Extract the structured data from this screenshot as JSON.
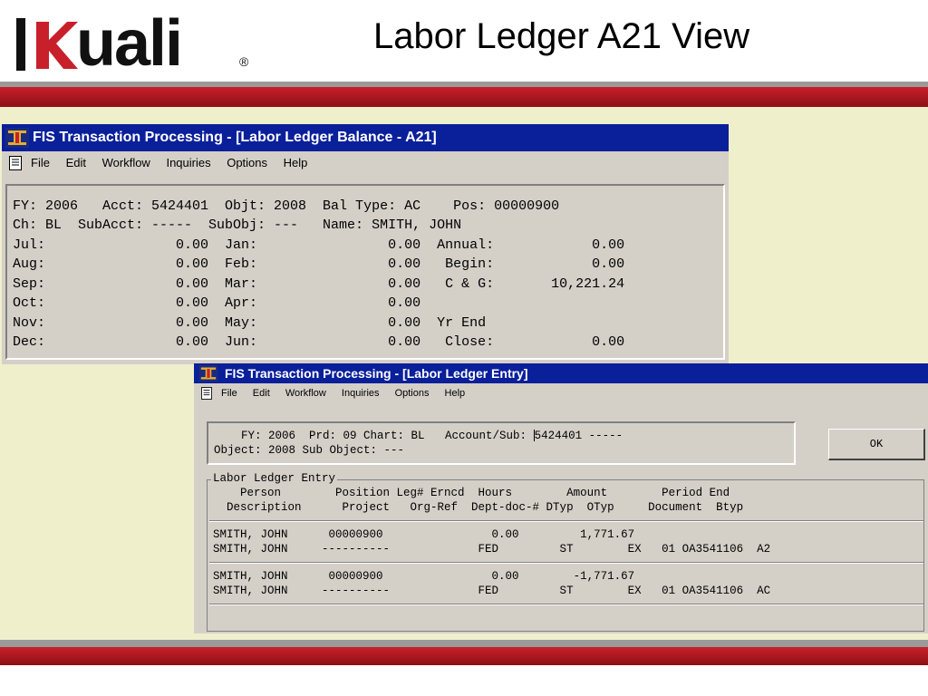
{
  "slide": {
    "logo_text": "uali",
    "logo_reg": "®",
    "title": "Labor Ledger A21 View",
    "colors": {
      "band_red": "#c8202a",
      "band_gray": "#9a9a9a",
      "beige": "#f0efcc",
      "titlebar_blue": "#0a1f9a",
      "window_gray": "#d4d0c8"
    }
  },
  "balance_window": {
    "title": "FIS Transaction Processing - [Labor Ledger Balance - A21]",
    "icon": "app-logo-icon",
    "menu": [
      "File",
      "Edit",
      "Workflow",
      "Inquiries",
      "Options",
      "Help"
    ],
    "lines": [
      "FY: 2006   Acct: 5424401  Objt: 2008  Bal Type: AC    Pos: 00000900",
      "Ch: BL  SubAcct: -----  SubObj: ---   Name: SMITH, JOHN",
      "Jul:                0.00  Jan:                0.00  Annual:            0.00",
      "Aug:                0.00  Feb:                0.00   Begin:            0.00",
      "Sep:                0.00  Mar:                0.00   C & G:       10,221.24",
      "Oct:                0.00  Apr:                0.00",
      "Nov:                0.00  May:                0.00  Yr End",
      "Dec:                0.00  Jun:                0.00   Close:            0.00"
    ]
  },
  "entry_window": {
    "title": "FIS Transaction Processing - [Labor Ledger Entry]",
    "icon": "app-logo-icon",
    "menu": [
      "File",
      "Edit",
      "Workflow",
      "Inquiries",
      "Options",
      "Help"
    ],
    "header_line1_a": "    FY: 2006  Prd: 09 Chart: BL   Account/Sub: ",
    "header_line1_b": "5424401 -----",
    "header_line2": "Object: 2008 Sub Object: ---",
    "ok_label": "OK",
    "group_legend": "Labor Ledger Entry",
    "col_header1": "    Person        Position Leg# Erncd  Hours        Amount        Period End",
    "col_header2": "  Description      Project   Org-Ref  Dept-doc-# DTyp  OTyp     Document  Btyp",
    "rows": [
      {
        "line1": "SMITH, JOHN      00000900                0.00         1,771.67",
        "line2": "SMITH, JOHN     ----------             FED         ST        EX   01 OA3541106  A2"
      },
      {
        "line1": "SMITH, JOHN      00000900                0.00        -1,771.67",
        "line2": "SMITH, JOHN     ----------             FED         ST        EX   01 OA3541106  AC"
      }
    ]
  }
}
